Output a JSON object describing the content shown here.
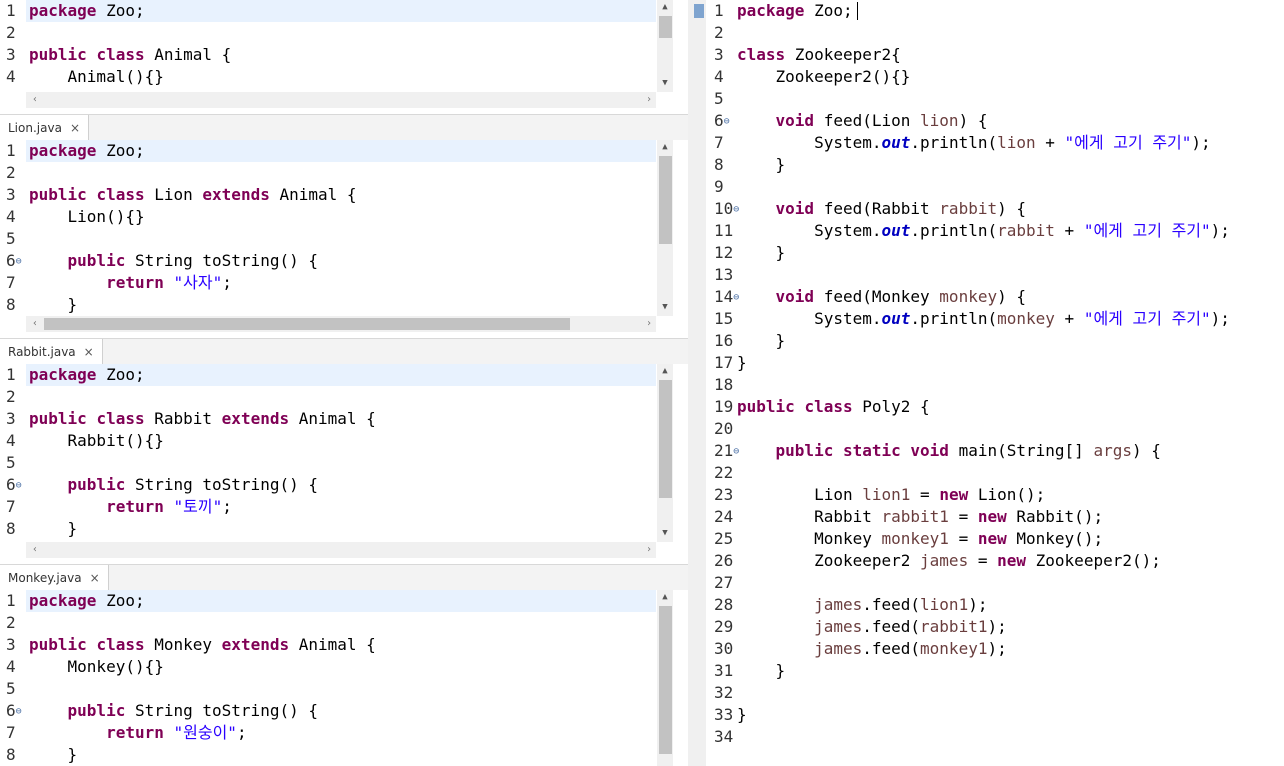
{
  "editors": [
    {
      "id": "animal",
      "tab": null,
      "lines": [
        {
          "n": "1",
          "hl": true,
          "tokens": [
            [
              "kw",
              "package"
            ],
            [
              "",
              " Zoo;"
            ]
          ]
        },
        {
          "n": "2",
          "tokens": []
        },
        {
          "n": "3",
          "tokens": [
            [
              "kw",
              "public"
            ],
            [
              "",
              " "
            ],
            [
              "kw",
              "class"
            ],
            [
              "",
              " Animal {"
            ]
          ]
        },
        {
          "n": "4",
          "tokens": [
            [
              "",
              "    Animal(){}"
            ]
          ]
        }
      ]
    },
    {
      "id": "lion",
      "tab": "Lion.java",
      "lines": [
        {
          "n": "1",
          "hl": true,
          "tokens": [
            [
              "kw",
              "package"
            ],
            [
              "",
              " Zoo;"
            ]
          ]
        },
        {
          "n": "2",
          "tokens": []
        },
        {
          "n": "3",
          "tokens": [
            [
              "kw",
              "public"
            ],
            [
              "",
              " "
            ],
            [
              "kw",
              "class"
            ],
            [
              "",
              " Lion "
            ],
            [
              "kw",
              "extends"
            ],
            [
              "",
              " Animal {"
            ]
          ]
        },
        {
          "n": "4",
          "tokens": [
            [
              "",
              "    Lion(){}"
            ]
          ]
        },
        {
          "n": "5",
          "tokens": []
        },
        {
          "n": "6",
          "fold": true,
          "tokens": [
            [
              "",
              "    "
            ],
            [
              "kw",
              "public"
            ],
            [
              "",
              " String toString() {"
            ]
          ]
        },
        {
          "n": "7",
          "tokens": [
            [
              "",
              "        "
            ],
            [
              "kw",
              "return"
            ],
            [
              "",
              " "
            ],
            [
              "str",
              "\"사자\""
            ],
            [
              "",
              ";"
            ]
          ]
        },
        {
          "n": "8",
          "tokens": [
            [
              "",
              "    }"
            ]
          ]
        }
      ]
    },
    {
      "id": "rabbit",
      "tab": "Rabbit.java",
      "lines": [
        {
          "n": "1",
          "hl": true,
          "tokens": [
            [
              "kw",
              "package"
            ],
            [
              "",
              " Zoo;"
            ]
          ]
        },
        {
          "n": "2",
          "tokens": []
        },
        {
          "n": "3",
          "tokens": [
            [
              "kw",
              "public"
            ],
            [
              "",
              " "
            ],
            [
              "kw",
              "class"
            ],
            [
              "",
              " Rabbit "
            ],
            [
              "kw",
              "extends"
            ],
            [
              "",
              " Animal {"
            ]
          ]
        },
        {
          "n": "4",
          "tokens": [
            [
              "",
              "    Rabbit(){}"
            ]
          ]
        },
        {
          "n": "5",
          "tokens": []
        },
        {
          "n": "6",
          "fold": true,
          "tokens": [
            [
              "",
              "    "
            ],
            [
              "kw",
              "public"
            ],
            [
              "",
              " String toString() {"
            ]
          ]
        },
        {
          "n": "7",
          "tokens": [
            [
              "",
              "        "
            ],
            [
              "kw",
              "return"
            ],
            [
              "",
              " "
            ],
            [
              "str",
              "\"토끼\""
            ],
            [
              "",
              ";"
            ]
          ]
        },
        {
          "n": "8",
          "tokens": [
            [
              "",
              "    }"
            ]
          ]
        }
      ]
    },
    {
      "id": "monkey",
      "tab": "Monkey.java",
      "lines": [
        {
          "n": "1",
          "hl": true,
          "tokens": [
            [
              "kw",
              "package"
            ],
            [
              "",
              " Zoo;"
            ]
          ]
        },
        {
          "n": "2",
          "tokens": []
        },
        {
          "n": "3",
          "tokens": [
            [
              "kw",
              "public"
            ],
            [
              "",
              " "
            ],
            [
              "kw",
              "class"
            ],
            [
              "",
              " Monkey "
            ],
            [
              "kw",
              "extends"
            ],
            [
              "",
              " Animal {"
            ]
          ]
        },
        {
          "n": "4",
          "tokens": [
            [
              "",
              "    Monkey(){}"
            ]
          ]
        },
        {
          "n": "5",
          "tokens": []
        },
        {
          "n": "6",
          "fold": true,
          "tokens": [
            [
              "",
              "    "
            ],
            [
              "kw",
              "public"
            ],
            [
              "",
              " String toString() {"
            ]
          ]
        },
        {
          "n": "7",
          "tokens": [
            [
              "",
              "        "
            ],
            [
              "kw",
              "return"
            ],
            [
              "",
              " "
            ],
            [
              "str",
              "\"원숭이\""
            ],
            [
              "",
              ";"
            ]
          ]
        },
        {
          "n": "8",
          "tokens": [
            [
              "",
              "    }"
            ]
          ]
        }
      ]
    },
    {
      "id": "poly2",
      "tab": null,
      "lines": [
        {
          "n": "1",
          "tokens": [
            [
              "kw",
              "package"
            ],
            [
              "",
              " Zoo;"
            ]
          ]
        },
        {
          "n": "2",
          "tokens": []
        },
        {
          "n": "3",
          "tokens": [
            [
              "kw",
              "class"
            ],
            [
              "",
              " Zookeeper2{"
            ]
          ]
        },
        {
          "n": "4",
          "tokens": [
            [
              "",
              "    Zookeeper2(){}"
            ]
          ]
        },
        {
          "n": "5",
          "tokens": []
        },
        {
          "n": "6",
          "fold": true,
          "tokens": [
            [
              "",
              "    "
            ],
            [
              "kw",
              "void"
            ],
            [
              "",
              " feed(Lion "
            ],
            [
              "var",
              "lion"
            ],
            [
              "",
              ") {"
            ]
          ]
        },
        {
          "n": "7",
          "tokens": [
            [
              "",
              "        System."
            ],
            [
              "fld",
              "out"
            ],
            [
              "",
              ".println("
            ],
            [
              "var",
              "lion"
            ],
            [
              "",
              " + "
            ],
            [
              "str",
              "\"에게 고기 주기\""
            ],
            [
              "",
              ");"
            ]
          ]
        },
        {
          "n": "8",
          "tokens": [
            [
              "",
              "    }"
            ]
          ]
        },
        {
          "n": "9",
          "tokens": []
        },
        {
          "n": "10",
          "fold": true,
          "tokens": [
            [
              "",
              "    "
            ],
            [
              "kw",
              "void"
            ],
            [
              "",
              " feed(Rabbit "
            ],
            [
              "var",
              "rabbit"
            ],
            [
              "",
              ") {"
            ]
          ]
        },
        {
          "n": "11",
          "tokens": [
            [
              "",
              "        System."
            ],
            [
              "fld",
              "out"
            ],
            [
              "",
              ".println("
            ],
            [
              "var",
              "rabbit"
            ],
            [
              "",
              " + "
            ],
            [
              "str",
              "\"에게 고기 주기\""
            ],
            [
              "",
              ");"
            ]
          ]
        },
        {
          "n": "12",
          "tokens": [
            [
              "",
              "    }"
            ]
          ]
        },
        {
          "n": "13",
          "tokens": []
        },
        {
          "n": "14",
          "fold": true,
          "tokens": [
            [
              "",
              "    "
            ],
            [
              "kw",
              "void"
            ],
            [
              "",
              " feed(Monkey "
            ],
            [
              "var",
              "monkey"
            ],
            [
              "",
              ") {"
            ]
          ]
        },
        {
          "n": "15",
          "tokens": [
            [
              "",
              "        System."
            ],
            [
              "fld",
              "out"
            ],
            [
              "",
              ".println("
            ],
            [
              "var",
              "monkey"
            ],
            [
              "",
              " + "
            ],
            [
              "str",
              "\"에게 고기 주기\""
            ],
            [
              "",
              ");"
            ]
          ]
        },
        {
          "n": "16",
          "tokens": [
            [
              "",
              "    }"
            ]
          ]
        },
        {
          "n": "17",
          "tokens": [
            [
              "",
              "}"
            ]
          ]
        },
        {
          "n": "18",
          "tokens": []
        },
        {
          "n": "19",
          "tokens": [
            [
              "kw",
              "public"
            ],
            [
              "",
              " "
            ],
            [
              "kw",
              "class"
            ],
            [
              "",
              " Poly2 {"
            ]
          ]
        },
        {
          "n": "20",
          "tokens": []
        },
        {
          "n": "21",
          "fold": true,
          "tokens": [
            [
              "",
              "    "
            ],
            [
              "kw",
              "public"
            ],
            [
              "",
              " "
            ],
            [
              "kw",
              "static"
            ],
            [
              "",
              " "
            ],
            [
              "kw",
              "void"
            ],
            [
              "",
              " main(String[] "
            ],
            [
              "var",
              "args"
            ],
            [
              "",
              ") {"
            ]
          ]
        },
        {
          "n": "22",
          "tokens": []
        },
        {
          "n": "23",
          "tokens": [
            [
              "",
              "        Lion "
            ],
            [
              "var",
              "lion1"
            ],
            [
              "",
              " = "
            ],
            [
              "kw",
              "new"
            ],
            [
              "",
              " Lion();"
            ]
          ]
        },
        {
          "n": "24",
          "tokens": [
            [
              "",
              "        Rabbit "
            ],
            [
              "var",
              "rabbit1"
            ],
            [
              "",
              " = "
            ],
            [
              "kw",
              "new"
            ],
            [
              "",
              " Rabbit();"
            ]
          ]
        },
        {
          "n": "25",
          "tokens": [
            [
              "",
              "        Monkey "
            ],
            [
              "var",
              "monkey1"
            ],
            [
              "",
              " = "
            ],
            [
              "kw",
              "new"
            ],
            [
              "",
              " Monkey();"
            ]
          ]
        },
        {
          "n": "26",
          "tokens": [
            [
              "",
              "        Zookeeper2 "
            ],
            [
              "var",
              "james"
            ],
            [
              "",
              " = "
            ],
            [
              "kw",
              "new"
            ],
            [
              "",
              " Zookeeper2();"
            ]
          ]
        },
        {
          "n": "27",
          "tokens": []
        },
        {
          "n": "28",
          "tokens": [
            [
              "",
              "        "
            ],
            [
              "var",
              "james"
            ],
            [
              "",
              ".feed("
            ],
            [
              "var",
              "lion1"
            ],
            [
              "",
              ");"
            ]
          ]
        },
        {
          "n": "29",
          "tokens": [
            [
              "",
              "        "
            ],
            [
              "var",
              "james"
            ],
            [
              "",
              ".feed("
            ],
            [
              "var",
              "rabbit1"
            ],
            [
              "",
              ");"
            ]
          ]
        },
        {
          "n": "30",
          "tokens": [
            [
              "",
              "        "
            ],
            [
              "var",
              "james"
            ],
            [
              "",
              ".feed("
            ],
            [
              "var",
              "monkey1"
            ],
            [
              "",
              ");"
            ]
          ]
        },
        {
          "n": "31",
          "tokens": [
            [
              "",
              "    }"
            ]
          ]
        },
        {
          "n": "32",
          "tokens": []
        },
        {
          "n": "33",
          "tokens": [
            [
              "",
              "}"
            ]
          ]
        },
        {
          "n": "34",
          "tokens": []
        }
      ]
    }
  ],
  "icons": {
    "tab_close": "×",
    "scroll_up": "▲",
    "scroll_down": "▼",
    "scroll_left": "‹",
    "scroll_right": "›",
    "fold": "⊖"
  },
  "colors": {
    "keyword": "#7f0055",
    "string": "#2a00ff",
    "field": "#0000c0",
    "variable": "#6a3e3e",
    "current_line": "#e8f2fe"
  }
}
